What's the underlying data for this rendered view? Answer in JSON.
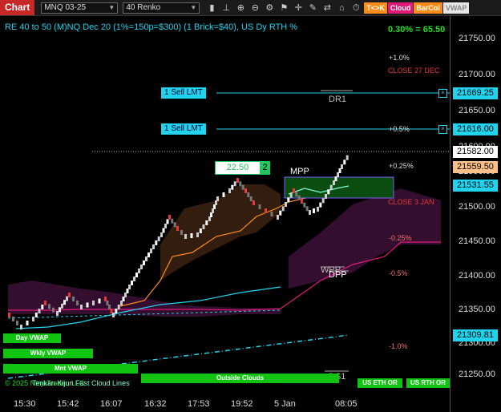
{
  "toolbar": {
    "chart_tab": "Chart",
    "instrument": "MNQ 03-25",
    "bar_type": "40 Renko",
    "btn_tk": "T<>K",
    "btn_cloud": "Cloud",
    "btn_barcol": "BarCol",
    "btn_vwap": "VWAP",
    "colors": {
      "tk": "#ff8c1a",
      "cloud": "#e0197a",
      "barcol": "#ff8c1a",
      "vwap": "#e6e6e6"
    }
  },
  "header": {
    "info": "RE 40 to 50 (M)NQ Dec 20 (1%=150p=$300) (1 Brick=$40), US Dy RTH %",
    "pct": "0.30% = 65.50"
  },
  "price_axis": {
    "ticks": [
      "21750.00",
      "21700.00",
      "21650.00",
      "21600.00",
      "21550.00",
      "21500.00",
      "21450.00",
      "21400.00",
      "21350.00",
      "21300.00",
      "21250.00"
    ],
    "tags": {
      "order1": "21669.25",
      "order2": "21616.00",
      "last": "21582.00",
      "orange": "21559.50",
      "cyan": "21531.55",
      "vwap": "21309.81"
    }
  },
  "time_axis": [
    "15:30",
    "15:42",
    "16:07",
    "16:32",
    "17:53",
    "19:52",
    "5 Jan",
    "08:05"
  ],
  "annotations": {
    "plus1": "+1.0%",
    "close27": "CLOSE 27 DEC",
    "dr1": "DR1",
    "plus05": "+0.5%",
    "plus025": "+0.25%",
    "close3": "CLOSE 3 JAN",
    "minus025": "-0.25%",
    "wpp": "WPP",
    "dpp": "DPP",
    "minus05": "-0.5%",
    "minus1": "-1.0%",
    "mpp": "MPP",
    "ds1": "DS1"
  },
  "orders": [
    {
      "label": "1 Sell LMT"
    },
    {
      "label": "1 Sell LMT"
    }
  ],
  "position_box": {
    "value": "22.50",
    "qty": "2"
  },
  "vwap_buttons": {
    "day": "Day VWAP",
    "wkly": "Wkly VWAP",
    "mnt": "Mnt VWAP",
    "outside": "Outside Clouds",
    "us_eth": "US ETH OR",
    "us_rth": "US RTH OR"
  },
  "footer": {
    "copyright": "© 2025 NinjaTrader, LLC",
    "overlay": "Tenkan Kijun Fast Cloud Lines"
  }
}
